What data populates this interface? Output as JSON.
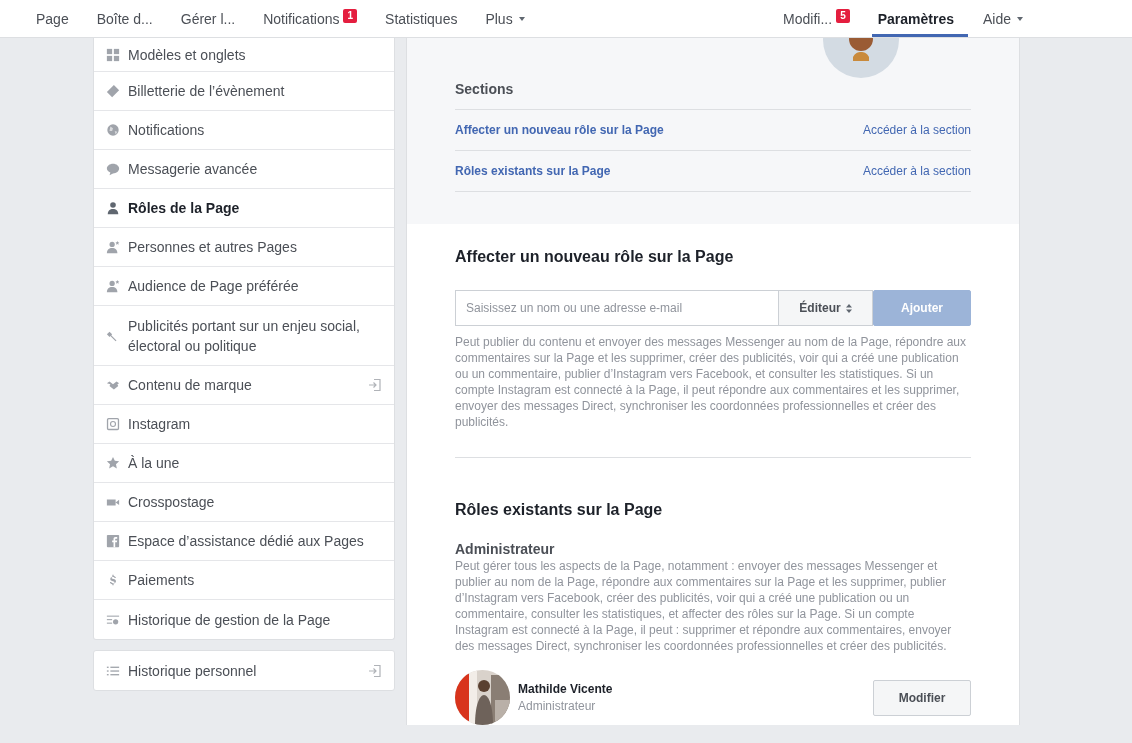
{
  "nav": {
    "left": [
      {
        "label": "Page",
        "selected": false,
        "dropdown": false
      },
      {
        "label": "Boîte d...",
        "selected": false,
        "dropdown": false
      },
      {
        "label": "Gérer l...",
        "selected": false,
        "dropdown": false
      },
      {
        "label": "Notifications",
        "badge": "1",
        "selected": false,
        "dropdown": false
      },
      {
        "label": "Statistiques",
        "selected": false,
        "dropdown": false
      },
      {
        "label": "Plus",
        "selected": false,
        "dropdown": true
      }
    ],
    "right": [
      {
        "label": "Modifi...",
        "badge": "5",
        "selected": false,
        "dropdown": false
      },
      {
        "label": "Paramètres",
        "selected": true,
        "dropdown": false
      },
      {
        "label": "Aide",
        "selected": false,
        "dropdown": true
      }
    ]
  },
  "sidebar": {
    "groups": [
      [
        {
          "label": "Modèles et onglets",
          "kind": "grid",
          "selected": false,
          "external": false
        },
        {
          "label": "Billetterie de l’évènement",
          "kind": "tag",
          "selected": false,
          "external": false
        },
        {
          "label": "Notifications",
          "kind": "globe",
          "selected": false,
          "external": false
        },
        {
          "label": "Messagerie avancée",
          "kind": "chat",
          "selected": false,
          "external": false
        },
        {
          "label": "Rôles de la Page",
          "kind": "person",
          "selected": true,
          "external": false
        },
        {
          "label": "Personnes et autres Pages",
          "kind": "person-star",
          "selected": false,
          "external": false
        },
        {
          "label": "Audience de Page préférée",
          "kind": "person-star",
          "selected": false,
          "external": false
        },
        {
          "label": "Publicités portant sur un enjeu social, électoral ou politique",
          "kind": "wrench",
          "selected": false,
          "external": false
        },
        {
          "label": "Contenu de marque",
          "kind": "handshake",
          "selected": false,
          "external": true
        },
        {
          "label": "Instagram",
          "kind": "camera",
          "selected": false,
          "external": false
        },
        {
          "label": "À la une",
          "kind": "star",
          "selected": false,
          "external": false
        },
        {
          "label": "Crosspostage",
          "kind": "video",
          "selected": false,
          "external": false
        },
        {
          "label": "Espace d’assistance dédié aux Pages",
          "kind": "f-square",
          "selected": false,
          "external": false
        },
        {
          "label": "Paiements",
          "kind": "dollar",
          "selected": false,
          "external": false
        },
        {
          "label": "Historique de gestion de la Page",
          "kind": "history",
          "selected": false,
          "external": false
        }
      ],
      [
        {
          "label": "Historique personnel",
          "kind": "list",
          "selected": false,
          "external": true
        }
      ]
    ]
  },
  "sections": {
    "heading": "Sections",
    "rows": [
      {
        "title": "Affecter un nouveau rôle sur la Page",
        "link": "Accéder à la section"
      },
      {
        "title": "Rôles existants sur la Page",
        "link": "Accéder à la section"
      }
    ]
  },
  "add_role": {
    "title": "Affecter un nouveau rôle sur la Page",
    "input": {
      "placeholder": "Saisissez un nom ou une adresse e-mail"
    },
    "role_select": {
      "value": "Éditeur"
    },
    "button": {
      "label": "Ajouter",
      "disabled": true
    },
    "description": "Peut publier du contenu et envoyer des messages Messenger au nom de la Page, répondre aux commentaires sur la Page et les supprimer, créer des publicités, voir qui a créé une publication ou un commentaire, publier d’Instagram vers Facebook, et consulter les statistiques. Si un compte Instagram est connecté à la Page, il peut répondre aux commentaires et les supprimer, envoyer des messages Direct, synchroniser les coordonnées professionnelles et créer des publicités."
  },
  "existing_roles": {
    "title": "Rôles existants sur la Page",
    "groups": [
      {
        "role": "Administrateur",
        "description": "Peut gérer tous les aspects de la Page, notamment : envoyer des messages Messenger et publier au nom de la Page, répondre aux commentaires sur la Page et les supprimer, publier d’Instagram vers Facebook, créer des publicités, voir qui a créé une publication ou un commentaire, consulter les statistiques, et affecter des rôles sur la Page. Si un compte Instagram est connecté à la Page, il peut : supprimer et répondre aux commentaires, envoyer des messages Direct, synchroniser les coordonnées professionnelles et créer des publicités.",
        "people": [
          {
            "name": "Mathilde Vicente",
            "role": "Administrateur",
            "button": "Modifier"
          }
        ]
      }
    ]
  }
}
